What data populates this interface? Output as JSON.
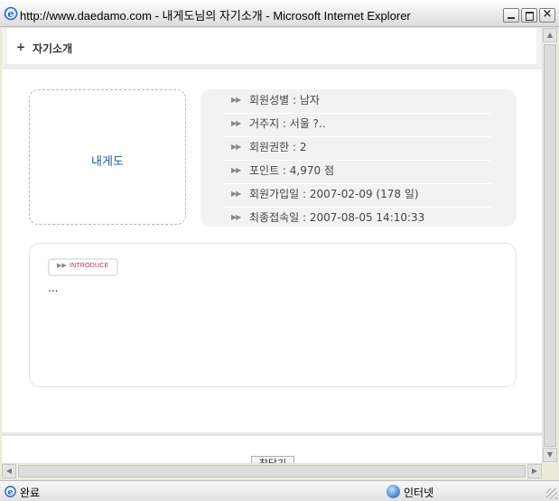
{
  "window": {
    "title": "http://www.daedamo.com - 내게도님의 자기소개 - Microsoft Internet Explorer"
  },
  "page": {
    "header_plus": "+",
    "header_title": "자기소개",
    "nickname": "내게도",
    "info_rows": [
      {
        "text": "회원성별 : 남자"
      },
      {
        "text": "거주지 : 서울 ?.."
      },
      {
        "text": "회원권한 : 2"
      },
      {
        "text": "포인트 : 4,970 점"
      },
      {
        "text": "회원가입일 : 2007-02-09 (178 일)"
      },
      {
        "text": "최종접속일 : 2007-08-05 14:10:33"
      }
    ],
    "intro_badge": "INTRODUCE",
    "intro_text": "...",
    "close_label": "창닫기"
  },
  "status": {
    "text": "완료",
    "zone": "인터넷"
  },
  "icons": {
    "app": "ie-icon",
    "zone": "internet-globe-icon",
    "bullet": "double-arrow-icon"
  },
  "colors": {
    "nickname": "#1e5aa0",
    "badge_text": "#b03050",
    "info_bg": "#f2f2f2"
  }
}
